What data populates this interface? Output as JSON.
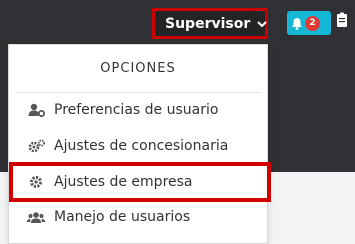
{
  "header": {
    "user_menu_label": "Supervisor",
    "notification_count": "2"
  },
  "dropdown": {
    "title": "OPCIONES",
    "items": [
      {
        "label": "Preferencias de usuario",
        "icon": "user-gear-icon"
      },
      {
        "label": "Ajustes de concesionaria",
        "icon": "gears-icon"
      },
      {
        "label": "Ajustes de empresa",
        "icon": "gear-icon",
        "highlighted": true
      },
      {
        "label": "Manejo de usuarios",
        "icon": "users-icon"
      }
    ]
  },
  "colors": {
    "header_bg": "#303134",
    "highlight": "#d10000",
    "notification_bg": "#14b8d6",
    "badge_bg": "#e53935"
  }
}
